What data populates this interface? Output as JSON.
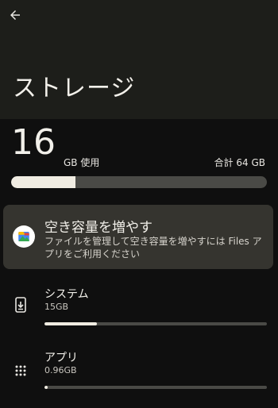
{
  "header": {
    "back_icon": "arrow-back-icon",
    "title": "ストレージ"
  },
  "summary": {
    "used_value": "16",
    "used_unit": "GB 使用",
    "total_label": "合計 64 GB",
    "used_fraction": 0.25
  },
  "suggestion_card": {
    "icon": "files-app-icon",
    "title": "空き容量を増やす",
    "description": "ファイルを管理して空き容量を増やすには Files アプリをご利用ください"
  },
  "categories": [
    {
      "icon": "phone-download-icon",
      "name": "システム",
      "size": "15GB",
      "fraction": 0.234
    },
    {
      "icon": "apps-grid-icon",
      "name": "アプリ",
      "size": "0.96GB",
      "fraction": 0.015
    }
  ],
  "colors": {
    "background": "#0f0f0f",
    "header_background": "#1d1e1a",
    "card_background": "#35342f",
    "bar_fill": "#f0ece2",
    "bar_track": "#4a4a46"
  }
}
